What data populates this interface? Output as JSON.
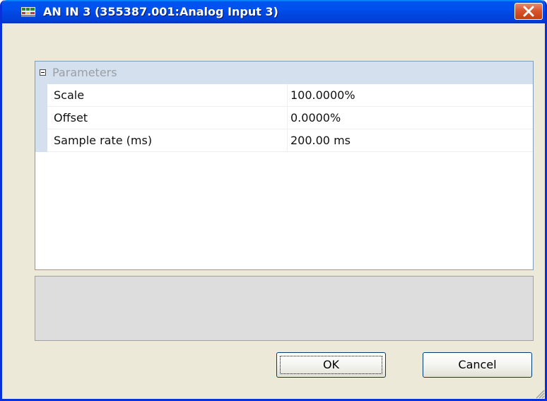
{
  "window": {
    "title": "AN IN 3 (355387.001:Analog Input 3)",
    "app_icon": "module-icon",
    "close_icon": "close-icon"
  },
  "grid": {
    "category": "Parameters",
    "rows": [
      {
        "name": "Scale",
        "value": "100.0000%"
      },
      {
        "name": "Offset",
        "value": "0.0000%"
      },
      {
        "name": "Sample rate (ms)",
        "value": "200.00 ms"
      }
    ]
  },
  "buttons": {
    "ok": "OK",
    "cancel": "Cancel"
  },
  "colors": {
    "titlebar": "#0050ee",
    "category_bg": "#d4e0ee",
    "close_button": "#d9562e"
  }
}
